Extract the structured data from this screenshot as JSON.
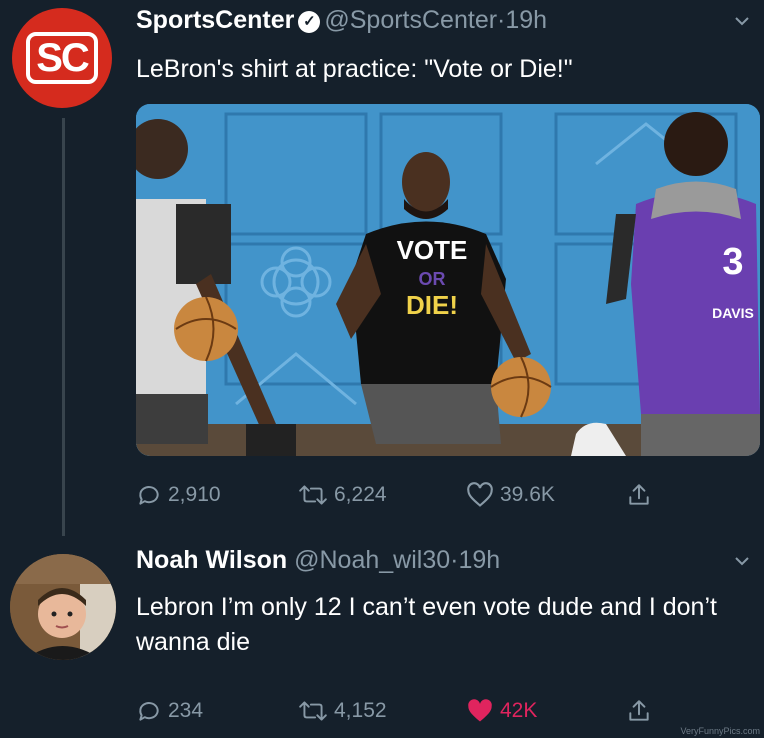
{
  "tweet1": {
    "author_name": "SportsCenter",
    "handle": "@SportsCenter",
    "time": "19h",
    "avatar_text": "SC",
    "text": "LeBron's shirt at practice: \"Vote or Die!\"",
    "photo": {
      "shirt_line1": "VOTE",
      "shirt_line2": "OR",
      "shirt_line3": "DIE!",
      "jersey_number": "3",
      "jersey_name": "DAVIS"
    },
    "replies": "2,910",
    "retweets": "6,224",
    "likes": "39.6K"
  },
  "tweet2": {
    "author_name": "Noah Wilson",
    "handle": "@Noah_wil30",
    "time": "19h",
    "text": "Lebron I’m only 12 I can’t even vote dude and I don’t wanna die",
    "replies": "234",
    "retweets": "4,152",
    "likes": "42K",
    "liked": true
  },
  "separator": "·",
  "watermark": "VeryFunnyPics.com",
  "colors": {
    "background": "#15202b",
    "secondary_text": "#8899a6",
    "like_active": "#e0245e",
    "brand_red": "#d52b1e"
  },
  "icons": {
    "verified": "verified-badge-icon",
    "reply": "comment-icon",
    "retweet": "retweet-icon",
    "like": "heart-icon",
    "share": "share-icon",
    "more": "chevron-down-icon"
  }
}
